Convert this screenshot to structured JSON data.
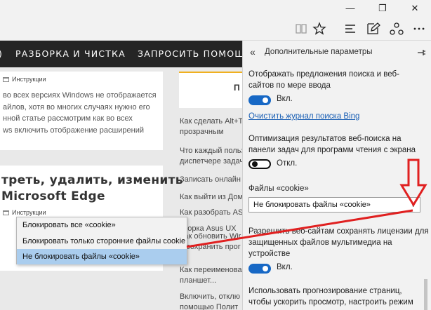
{
  "window": {
    "minimize_glyph": "—",
    "restore_glyph": "❐",
    "close_glyph": "✕"
  },
  "toolbar": {
    "icons": [
      "reading-view-icon",
      "favorite-star-icon",
      "hub-icon",
      "web-note-icon",
      "share-icon",
      "more-icon"
    ]
  },
  "page": {
    "nav": {
      "items": [
        "РАЗБОРКА И ЧИСТКА",
        "ЗАПРОСИТЬ ПОМОЩ"
      ]
    },
    "card1": {
      "category": "Инструкции",
      "snippet": "во всех версиях Windows не отображается\nайлов, хотя во многих случаях нужно его\nнной статье рассмотрим как во всех\nws включить отображение расширений"
    },
    "card2": {
      "headline": "треть, удалить, изменить\nMicrosoft Edge",
      "category": "Инструкции"
    },
    "sidebar": {
      "tab_letter": "П",
      "links": [
        "Как сделать Alt+T\nпрозрачным",
        "Что каждый польз\nдиспетчере задач",
        "Записать онлайн",
        "Как выйти из Дом",
        "Как разобрать ASUS",
        "зборка Asus UX",
        "Как обновить Wir\nи сохранить прог",
        "Как переименова\nпланшет...",
        "Включить, отклю\nпомощью Полит"
      ]
    }
  },
  "dropdown": {
    "options": [
      "Блокировать все «cookie»",
      "Блокировать только сторонние файлы cookie",
      "Не блокировать файлы «cookie»"
    ],
    "selected_index": 2
  },
  "settings": {
    "title": "Дополнительные параметры",
    "search_suggestions_label": "Отображать предложения поиска и веб-\nсайтов по мере ввода",
    "search_suggestions_state": "Вкл.",
    "search_suggestions_on": true,
    "clear_bing_link": "Очистить журнал поиска Bing",
    "taskbar_opt_label": "Оптимизация результатов веб-поиска на\nпанели задач для программ чтения с экрана",
    "taskbar_opt_state": "Откл.",
    "taskbar_opt_on": false,
    "cookies_label": "Файлы «cookie»",
    "cookies_value": "Не блокировать файлы «cookie»",
    "licenses_label": "Разрешить веб-сайтам сохранять лицензии для\nзащищенных файлов мультимедиа на\nустройстве",
    "licenses_state": "Вкл.",
    "licenses_on": true,
    "prediction_label": "Использовать прогнозирование страниц,\nчтобы ускорить просмотр, настроить режим"
  },
  "colors": {
    "accent_toggle": "#1768c5",
    "link": "#1a5fb4",
    "annotation": "#e02020",
    "selected_option": "#aacdee"
  }
}
